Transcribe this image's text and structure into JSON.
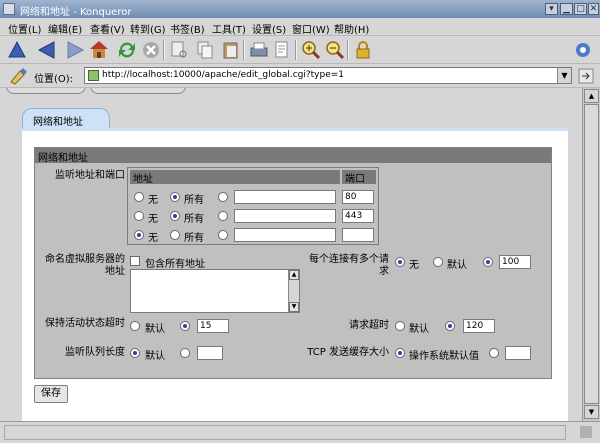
{
  "window": {
    "title": "网络和地址 - Konqueror",
    "controls": [
      "▾",
      "▁",
      "□",
      "✕"
    ]
  },
  "menu": [
    "位置(L)",
    "编辑(E)",
    "查看(V)",
    "转到(G)",
    "书签(B)",
    "工具(T)",
    "设置(S)",
    "窗口(W)",
    "帮助(H)"
  ],
  "toolbar": {
    "icons": [
      "up-icon",
      "back-icon",
      "forward-icon",
      "home-icon",
      "reload-icon",
      "stop-icon",
      "cut-icon",
      "copy-icon",
      "paste-icon",
      "print-icon",
      "print-preview-icon",
      "zoom-in-icon",
      "zoom-out-icon",
      "lock-icon",
      "settings-icon"
    ]
  },
  "location": {
    "label": "位置(O):",
    "url": "http://localhost:10000/apache/edit_global.cgi?type=1"
  },
  "page": {
    "section_tab": "网络和地址",
    "form_header": "网络和地址",
    "listen": {
      "label": "监听地址和端口",
      "col_address": "地址",
      "col_port": "端口",
      "rows": [
        {
          "opt_none": "无",
          "opt_all": "所有",
          "selected": "all",
          "address": "",
          "port": "80"
        },
        {
          "opt_none": "无",
          "opt_all": "所有",
          "selected": "all",
          "address": "",
          "port": "443"
        },
        {
          "opt_none": "无",
          "opt_all": "所有",
          "selected": "none",
          "address": "",
          "port": ""
        }
      ]
    },
    "vhost": {
      "label": "命名虚拟服务器的地址",
      "include_all": "包含所有地址"
    },
    "max_requests": {
      "label": "每个连接有多个请求",
      "opt_none": "无",
      "opt_default": "默认",
      "value": "100"
    },
    "keepalive": {
      "label": "保持活动状态超时",
      "opt_default": "默认",
      "value": "15"
    },
    "request_timeout": {
      "label": "请求超时",
      "opt_default": "默认",
      "value": "120"
    },
    "listen_queue": {
      "label": "监听队列长度",
      "opt_default": "默认",
      "value": ""
    },
    "tcp_buffer": {
      "label": "TCP 发送缓存大小",
      "opt_os_default": "操作系统默认值",
      "value": ""
    },
    "save_label": "保存"
  }
}
